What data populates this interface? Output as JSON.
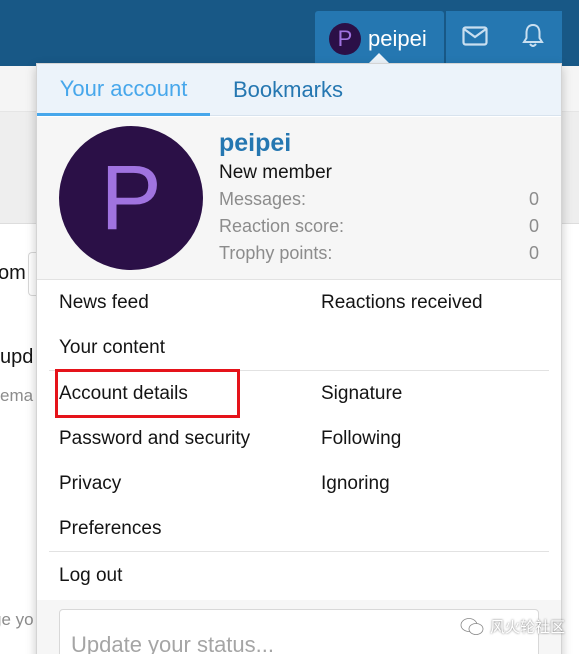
{
  "background": {
    "frag_om": "om",
    "frag_upd": "l upd",
    "frag_ema": "ema",
    "frag_gey": "ge yo"
  },
  "nav": {
    "avatar_letter": "P",
    "username": "peipei",
    "inbox_icon": "envelope-icon",
    "alerts_icon": "bell-icon"
  },
  "menu": {
    "tabs": [
      {
        "label": "Your account",
        "active": true
      },
      {
        "label": "Bookmarks",
        "active": false
      }
    ],
    "profile": {
      "avatar_letter": "P",
      "name": "peipei",
      "title": "New member",
      "stats": [
        {
          "label": "Messages:",
          "value": "0"
        },
        {
          "label": "Reaction score:",
          "value": "0"
        },
        {
          "label": "Trophy points:",
          "value": "0"
        }
      ]
    },
    "links": {
      "news_feed": "News feed",
      "reactions_received": "Reactions received",
      "your_content": "Your content",
      "account_details": "Account details",
      "signature": "Signature",
      "password_security": "Password and security",
      "following": "Following",
      "privacy": "Privacy",
      "ignoring": "Ignoring",
      "preferences": "Preferences",
      "log_out": "Log out"
    },
    "status_placeholder": "Update your status..."
  },
  "watermark": "风火轮社区",
  "colors": {
    "topbar": "#185886",
    "nav_active": "#2577b1",
    "link_blue": "#2577b1",
    "tab_active": "#47a7eb",
    "avatar_bg": "#2b1047",
    "avatar_fg": "#a073e0",
    "highlight": "#e5131a"
  }
}
